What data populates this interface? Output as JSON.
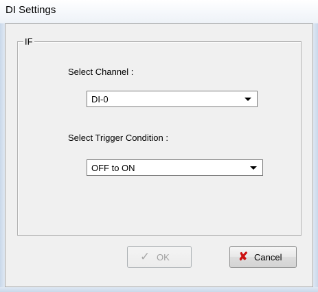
{
  "window": {
    "title": "DI Settings"
  },
  "group": {
    "label": "IF"
  },
  "channel": {
    "label": "Select Channel :",
    "value": "DI-0"
  },
  "trigger": {
    "label": "Select Trigger Condition :",
    "value": "OFF to ON"
  },
  "buttons": {
    "ok": {
      "label": "OK",
      "icon": "checkmark-icon",
      "enabled": false
    },
    "cancel": {
      "label": "Cancel",
      "icon": "red-x-icon",
      "enabled": true
    }
  },
  "colors": {
    "cancel_icon": "#cc1111",
    "disabled_text": "#a0a0a0"
  }
}
